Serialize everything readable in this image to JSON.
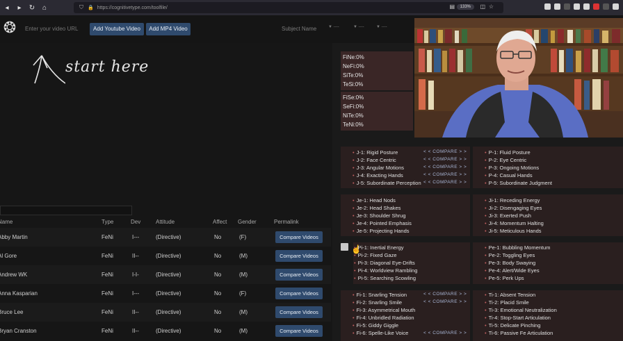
{
  "browser": {
    "url": "https://cognitivetype.com/toolfile/",
    "zoom": "133%"
  },
  "toolbar": {
    "url_placeholder": "Enter your video URL",
    "add_youtube": "Add Youtube Video",
    "add_mp4": "Add MP4 Video",
    "subject_label": "Subject Name",
    "selects": [
      "▼ ----",
      "▼ ----",
      "▼ ----"
    ]
  },
  "start_hint": "start here",
  "table": {
    "headers": [
      "Name",
      "Type",
      "Dev",
      "Attitude",
      "Affect",
      "Gender",
      "Permalink"
    ],
    "compare_label": "Compare Videos",
    "rows": [
      {
        "name": "Abby Martin",
        "type": "FeNi",
        "dev": "I---",
        "attitude": "(Directive)",
        "affect": "No",
        "gender": "(F)"
      },
      {
        "name": "Al Gore",
        "type": "FeNi",
        "dev": "II--",
        "attitude": "(Directive)",
        "affect": "No",
        "gender": "(M)"
      },
      {
        "name": "Andrew WK",
        "type": "FeNi",
        "dev": "I-I-",
        "attitude": "(Directive)",
        "affect": "No",
        "gender": "(M)"
      },
      {
        "name": "Anna Kasparian",
        "type": "FeNi",
        "dev": "I---",
        "attitude": "(Directive)",
        "affect": "No",
        "gender": "(F)"
      },
      {
        "name": "Bruce Lee",
        "type": "FeNi",
        "dev": "II--",
        "attitude": "(Directive)",
        "affect": "No",
        "gender": "(M)"
      },
      {
        "name": "Bryan Cranston",
        "type": "FeNi",
        "dev": "II--",
        "attitude": "(Directive)",
        "affect": "No",
        "gender": "(M)"
      }
    ]
  },
  "functions": {
    "top": [
      "FiNe:0%",
      "NeFi:0%",
      "SiTe:0%",
      "TeSi:0%"
    ],
    "bottom": [
      "FiSe:0%",
      "SeFi:0%",
      "NiTe:0%",
      "TeNi:0%"
    ]
  },
  "compare_label": "< < COMPARE > >",
  "groups": {
    "j": [
      "J-1: Rigid Posture",
      "J-2: Face Centric",
      "J-3: Angular Motions",
      "J-4: Exacting Hands",
      "J-5: Subordinate Perception"
    ],
    "p": [
      "P-1: Fluid Posture",
      "P-2: Eye Centric",
      "P-3: Ongoing Motions",
      "P-4: Casual Hands",
      "P-5: Subordinate Judgment"
    ],
    "je": [
      "Je-1: Head Nods",
      "Je-2: Head Shakes",
      "Je-3: Shoulder Shrug",
      "Je-4: Pointed Emphasis",
      "Je-5: Projecting Hands"
    ],
    "ji": [
      "Ji-1: Receding Energy",
      "Ji-2: Disengaging Eyes",
      "Ji-3: Exerted Push",
      "Ji-4: Momentum Halting",
      "Ji-5: Meticulous Hands"
    ],
    "pi": [
      "Pi-1: Inertial Energy",
      "Pi-2: Fixed Gaze",
      "Pi-3: Diagonal Eye-Drifts",
      "Pi-4: Worldview Rambling",
      "Pi-5: Searching Scowling"
    ],
    "pe": [
      "Pe-1: Bubbling Momentum",
      "Pe-2: Toggling Eyes",
      "Pe-3: Body Swaying",
      "Pe-4: Alert/Wide Eyes",
      "Pe-5: Perk Ups"
    ],
    "fi": [
      "Fi-1: Snarling Tension",
      "Fi-2: Snarling Smile",
      "Fi-3: Asymmetrical Mouth",
      "Fi-4: Unbridled Radiation",
      "Fi-5: Giddy Giggle",
      "Fi-6: Spelle-Like Voice"
    ],
    "ti": [
      "Ti-1: Absent Tension",
      "Ti-2: Placid Smile",
      "Ti-3: Emotional Neutralization",
      "Ti-4: Stop-Start Articulation",
      "Ti-5: Delicate Pinching",
      "Ti-6: Passive Fe Articulation"
    ]
  },
  "colors": {
    "button": "#2f4a6d",
    "group_bg": "#2a1f1f",
    "func_bg": "#3a2626"
  }
}
